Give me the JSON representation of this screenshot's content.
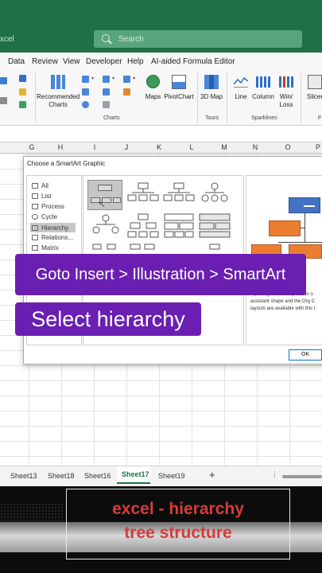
{
  "titlebar": {
    "app_name": "xcel",
    "search_placeholder": "Search"
  },
  "menu": [
    "Data",
    "Review",
    "View",
    "Developer",
    "Help",
    "AI-aided Formula Editor"
  ],
  "ribbon": {
    "recommended_charts": "Recommended Charts",
    "maps": "Maps",
    "pivotchart": "PivotChart",
    "map3d": "3D Map",
    "line": "Line",
    "column": "Column",
    "winloss": "Win/ Loss",
    "slicer": "Slicer",
    "group_charts": "Charts",
    "group_tours": "Tours",
    "group_sparklines": "Sparklines",
    "group_f": "F"
  },
  "columns": [
    "G",
    "H",
    "I",
    "J",
    "K",
    "L",
    "M",
    "N",
    "O",
    "P"
  ],
  "dialog": {
    "title": "Choose a SmartArt Graphic",
    "categories": [
      "All",
      "List",
      "Process",
      "Cycle",
      "Hierarchy",
      "Relations...",
      "Matrix"
    ],
    "selected_category": "Hierarchy",
    "description_lines": [
      "reporting relationships in an o",
      "assistant shape and the Org C",
      "layouts are available with this l"
    ],
    "ok_label": "OK"
  },
  "overlay": {
    "line1": "Goto Insert > Illustration > SmartArt",
    "line2": "Select hierarchy"
  },
  "sheet_tabs": [
    "Sheet13",
    "Sheet18",
    "Sheet16",
    "Sheet17",
    "Sheet19"
  ],
  "active_sheet": "Sheet17",
  "add_sheet": "+",
  "caption": {
    "line1": "excel - hierarchy",
    "line2": "tree structure"
  }
}
